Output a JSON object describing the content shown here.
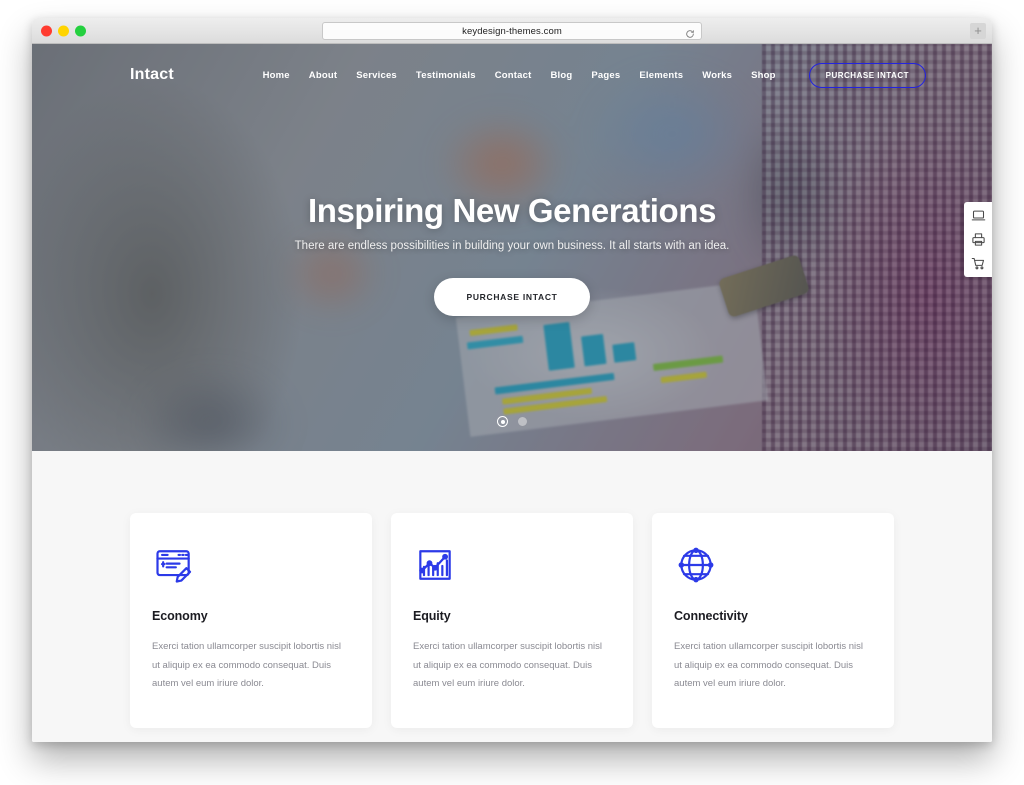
{
  "browser": {
    "url": "keydesign-themes.com",
    "reload_icon": "reload-icon",
    "newtab_label": "+",
    "traffic_lights": [
      "close",
      "minimize",
      "maximize"
    ]
  },
  "site": {
    "logo": "Intact",
    "nav_links": [
      {
        "label": "Home"
      },
      {
        "label": "About"
      },
      {
        "label": "Services"
      },
      {
        "label": "Testimonials"
      },
      {
        "label": "Contact"
      },
      {
        "label": "Blog"
      },
      {
        "label": "Pages"
      },
      {
        "label": "Elements"
      },
      {
        "label": "Works"
      },
      {
        "label": "Shop"
      }
    ],
    "nav_cta": "PURCHASE INTACT"
  },
  "hero": {
    "title": "Inspiring New Generations",
    "subtitle": "There are endless possibilities in building your own business. It all starts with an idea.",
    "button": "PURCHASE INTACT",
    "slides": [
      {
        "active": true
      },
      {
        "active": false
      }
    ]
  },
  "side_toolbar": {
    "items": [
      {
        "icon": "laptop-icon"
      },
      {
        "icon": "printer-icon"
      },
      {
        "icon": "shopping-cart-icon"
      }
    ]
  },
  "features": {
    "cards": [
      {
        "icon": "cheque-pen-icon",
        "title": "Economy",
        "text": "Exerci tation ullamcorper suscipit lobortis nisl ut aliquip ex ea commodo consequat. Duis autem vel eum iriure dolor."
      },
      {
        "icon": "bar-chart-growth-icon",
        "title": "Equity",
        "text": "Exerci tation ullamcorper suscipit lobortis nisl ut aliquip ex ea commodo consequat. Duis autem vel eum iriure dolor."
      },
      {
        "icon": "globe-network-icon",
        "title": "Connectivity",
        "text": "Exerci tation ullamcorper suscipit lobortis nisl ut aliquip ex ea commodo consequat. Duis autem vel eum iriure dolor."
      }
    ]
  },
  "colors": {
    "accent_blue": "#2c3ae8",
    "nav_cta_border": "#2323e0",
    "section_bg": "#f7f7f7",
    "card_bg": "#ffffff",
    "title_text": "#1c1c22",
    "body_text": "#8a8a92"
  }
}
